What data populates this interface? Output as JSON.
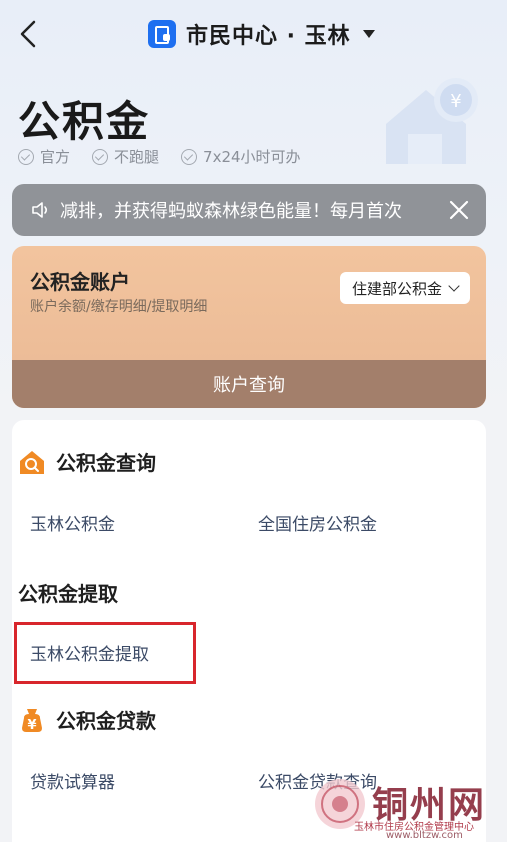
{
  "header": {
    "title": "市民中心 · 玉林"
  },
  "page": {
    "title": "公积金",
    "features": [
      "官方",
      "不跑腿",
      "7x24小时可办"
    ]
  },
  "notice": {
    "text": "减排，并获得蚂蚁森林绿色能量！每月首次"
  },
  "account_card": {
    "title": "公积金账户",
    "subtitle": "账户余额/缴存明细/提取明细",
    "selector": "住建部公积金",
    "query_button": "账户查询"
  },
  "sections": {
    "query": {
      "title": "公积金查询",
      "links": [
        "玉林公积金",
        "全国住房公积金"
      ]
    },
    "withdraw": {
      "title": "公积金提取",
      "links": [
        "玉林公积金提取"
      ]
    },
    "loan": {
      "title": "公积金贷款",
      "links": [
        "贷款试算器",
        "公积金贷款查询"
      ]
    }
  },
  "watermark": {
    "title": "铜州网",
    "subtitle": "玉林市住房公积金管理中心",
    "url": "www.bltzw.com"
  },
  "colors": {
    "accent_blue": "#1e6ff0",
    "section_icon_orange": "#f08a24",
    "highlight_red": "#d8262c"
  }
}
